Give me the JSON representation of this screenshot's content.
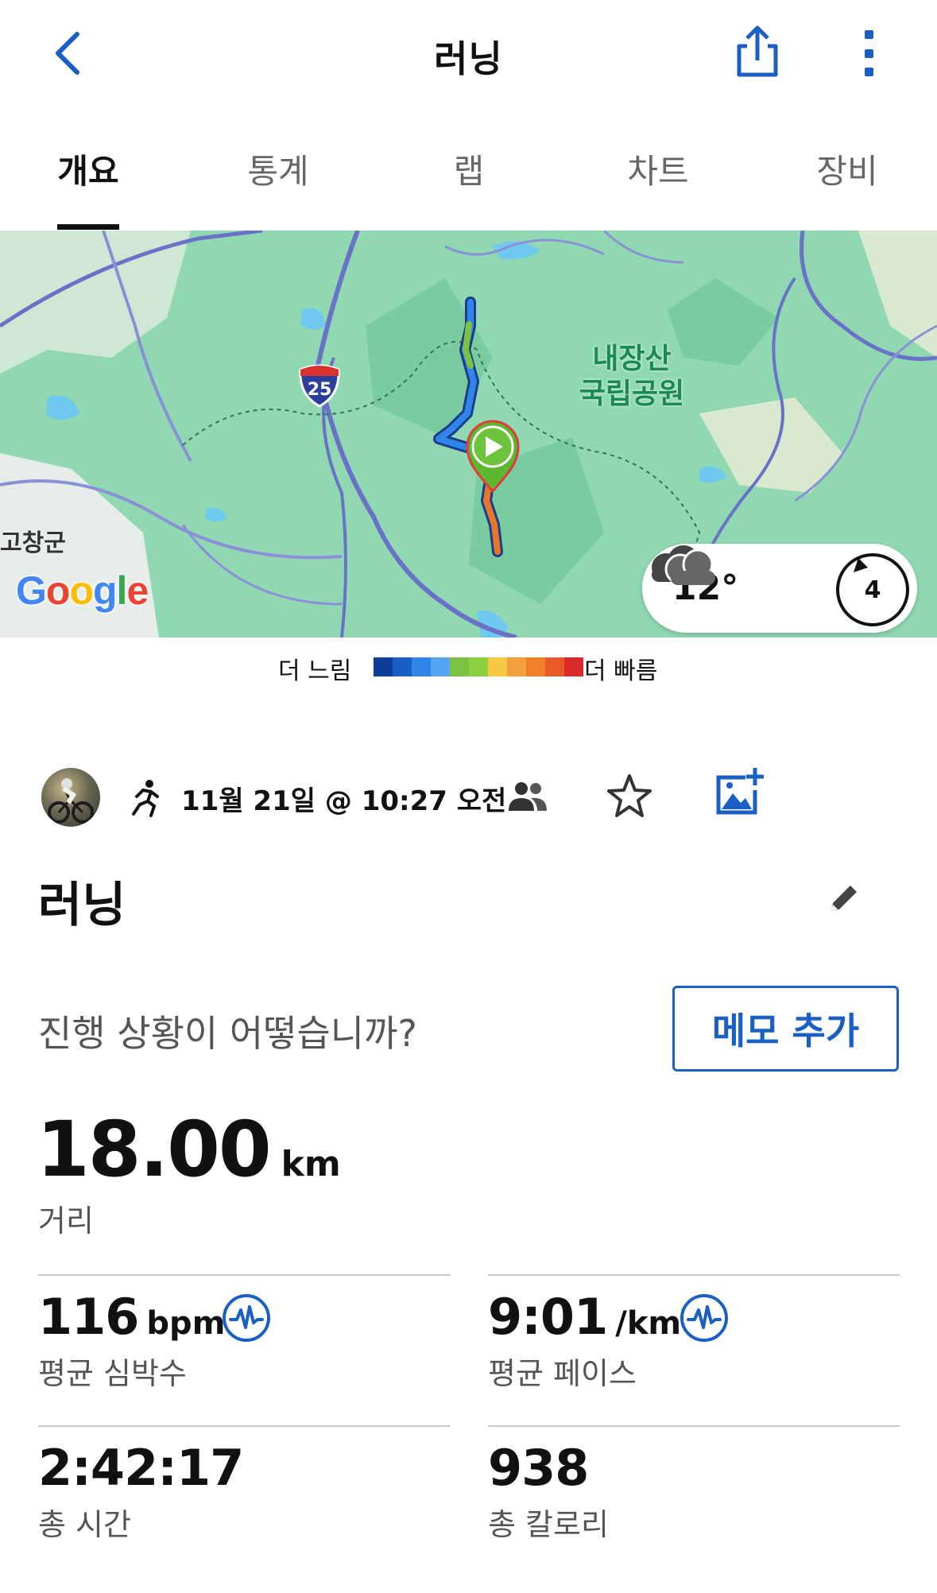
{
  "header": {
    "title": "러닝"
  },
  "tabs": [
    {
      "label": "개요"
    },
    {
      "label": "통계"
    },
    {
      "label": "랩"
    },
    {
      "label": "차트"
    },
    {
      "label": "장비"
    }
  ],
  "map": {
    "park_label_line1": "내장산",
    "park_label_line2": "국립공원",
    "town_label": "고창군",
    "highway_number": "25",
    "logo_text": "Google",
    "weather": {
      "temperature": "12°",
      "condition_icon": "cloud-icon",
      "wind_speed": "4"
    }
  },
  "legend": {
    "slow_label": "더 느림",
    "fast_label": "더 빠름",
    "colors": [
      "#0d3f9a",
      "#1a5fc4",
      "#2f86e8",
      "#54a6f2",
      "#7cc242",
      "#8cd040",
      "#f6c844",
      "#f4a040",
      "#f07f2a",
      "#e85a28",
      "#d92b2b"
    ]
  },
  "activity": {
    "date_time": "11월 21일 @ 10:27 오전",
    "name": "러닝",
    "prompt": "진행 상황이 어떻습니까?",
    "memo_button": "메모 추가"
  },
  "stats": {
    "distance": {
      "value": "18.00",
      "unit": "km",
      "label": "거리"
    },
    "heart_rate": {
      "value": "116",
      "unit": "bpm",
      "label": "평균 심박수"
    },
    "pace": {
      "value": "9:01",
      "unit": "/km",
      "label": "평균 페이스"
    },
    "total_time": {
      "value": "2:42:17",
      "label": "총 시간"
    },
    "calories": {
      "value": "938",
      "label": "총 칼로리"
    }
  },
  "colors": {
    "accent": "#1a5fc4",
    "map_green": "#8fd8b2"
  }
}
